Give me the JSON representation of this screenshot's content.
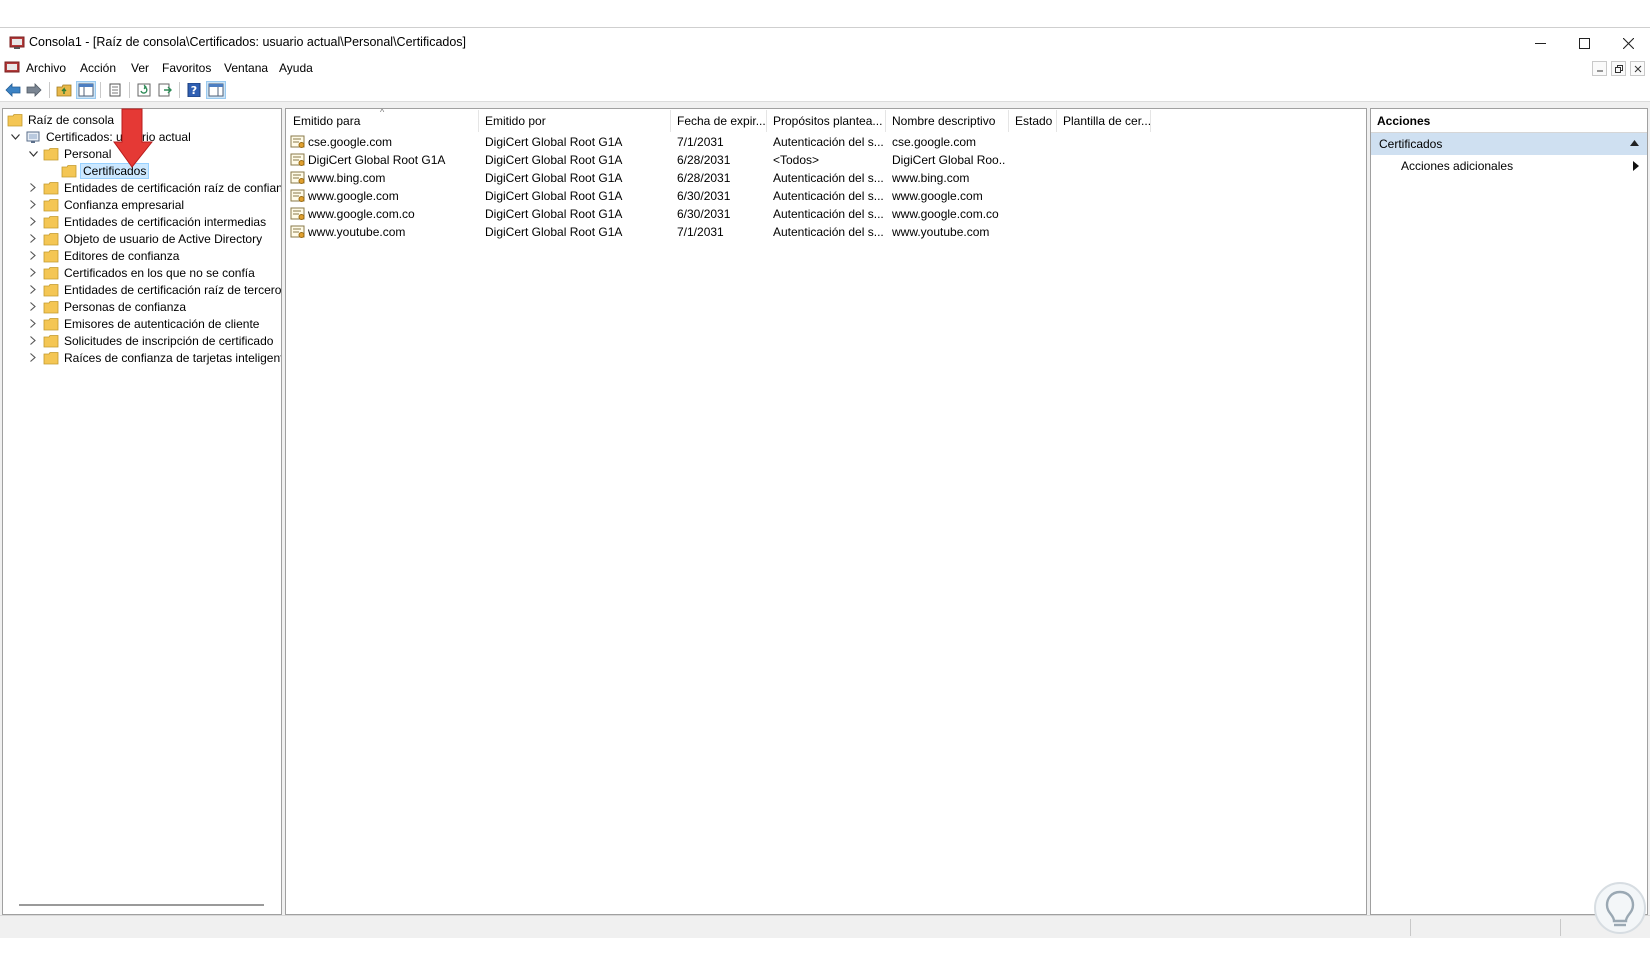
{
  "window": {
    "title": "Consola1 - [Raíz de consola\\Certificados: usuario actual\\Personal\\Certificados]"
  },
  "menu": [
    "Archivo",
    "Acción",
    "Ver",
    "Favoritos",
    "Ventana",
    "Ayuda"
  ],
  "toolbar": [
    {
      "icon": "back-arrow-icon"
    },
    {
      "icon": "forward-arrow-icon"
    },
    {
      "icon": "up-folder-icon"
    },
    {
      "icon": "show-hide-console-tree-icon"
    },
    {
      "icon": "delete-icon"
    },
    {
      "icon": "refresh-icon"
    },
    {
      "icon": "export-list-icon"
    },
    {
      "icon": "help-icon"
    },
    {
      "icon": "show-hide-action-pane-icon"
    }
  ],
  "tree": {
    "root": "Raíz de consola",
    "store": "Certificados: usuario actual",
    "personal": "Personal",
    "selected": "Certificados",
    "stores": [
      "Entidades de certificación raíz de confianza",
      "Confianza empresarial",
      "Entidades de certificación intermedias",
      "Objeto de usuario de Active Directory",
      "Editores de confianza",
      "Certificados en los que no se confía",
      "Entidades de certificación raíz de terceros",
      "Personas de confianza",
      "Emisores de autenticación de cliente",
      "Solicitudes de inscripción de certificado",
      "Raíces de confianza de tarjetas inteligentes"
    ]
  },
  "list": {
    "columns": [
      "Emitido para",
      "Emitido por",
      "Fecha de expir...",
      "Propósitos plantea...",
      "Nombre descriptivo",
      "Estado",
      "Plantilla de cer..."
    ],
    "rows": [
      [
        "cse.google.com",
        "DigiCert Global Root G1A",
        "7/1/2031",
        "Autenticación del s...",
        "cse.google.com",
        "",
        ""
      ],
      [
        "DigiCert Global Root G1A",
        "DigiCert Global Root G1A",
        "6/28/2031",
        "<Todos>",
        "DigiCert Global Roo...",
        "",
        ""
      ],
      [
        "www.bing.com",
        "DigiCert Global Root G1A",
        "6/28/2031",
        "Autenticación del s...",
        "www.bing.com",
        "",
        ""
      ],
      [
        "www.google.com",
        "DigiCert Global Root G1A",
        "6/30/2031",
        "Autenticación del s...",
        "www.google.com",
        "",
        ""
      ],
      [
        "www.google.com.co",
        "DigiCert Global Root G1A",
        "6/30/2031",
        "Autenticación del s...",
        "www.google.com.co",
        "",
        ""
      ],
      [
        "www.youtube.com",
        "DigiCert Global Root G1A",
        "7/1/2031",
        "Autenticación del s...",
        "www.youtube.com",
        "",
        ""
      ]
    ]
  },
  "actions": {
    "header": "Acciones",
    "section": "Certificados",
    "item": "Acciones adicionales"
  },
  "colors": {
    "selection": "#cce8ff",
    "section": "#cfe0f1",
    "annotation_arrow": "#e53935"
  }
}
